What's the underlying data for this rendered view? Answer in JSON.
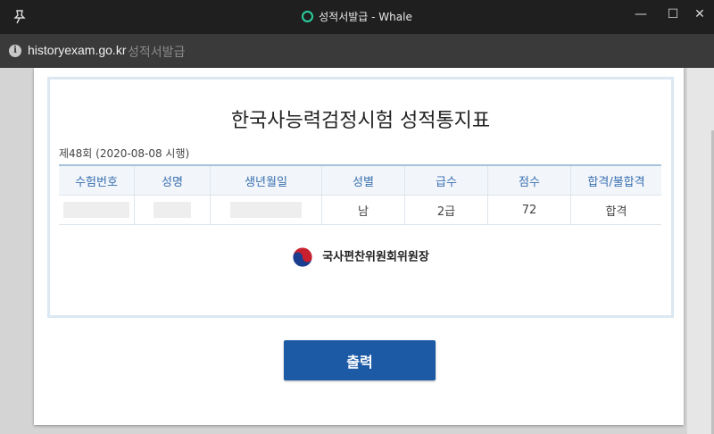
{
  "window": {
    "title": "성적서발급 - Whale",
    "minimize_glyph": "—",
    "maximize_glyph": "☐",
    "close_glyph": "✕"
  },
  "address": {
    "domain": "historyexam.go.kr",
    "page_title": "성적서발급",
    "info_glyph": "i"
  },
  "certificate": {
    "title": "한국사능력검정시험 성적통지표",
    "round": "제48회 (2020-08-08 시행)",
    "headers": [
      "수험번호",
      "성명",
      "생년월일",
      "성별",
      "급수",
      "점수",
      "합격/불합격"
    ],
    "row": {
      "exam_number": "",
      "name": "",
      "birth_date": "",
      "gender": "남",
      "grade": "2급",
      "score": "72",
      "result": "합격"
    },
    "issuer": "국사편찬위원회위원장"
  },
  "actions": {
    "print_label": "출력"
  },
  "colors": {
    "accent": "#1c5aa6",
    "header_text": "#3a6fb0",
    "whale_green": "#2bd0a0",
    "emblem_red": "#c8202f",
    "emblem_blue": "#1a3d8f"
  }
}
